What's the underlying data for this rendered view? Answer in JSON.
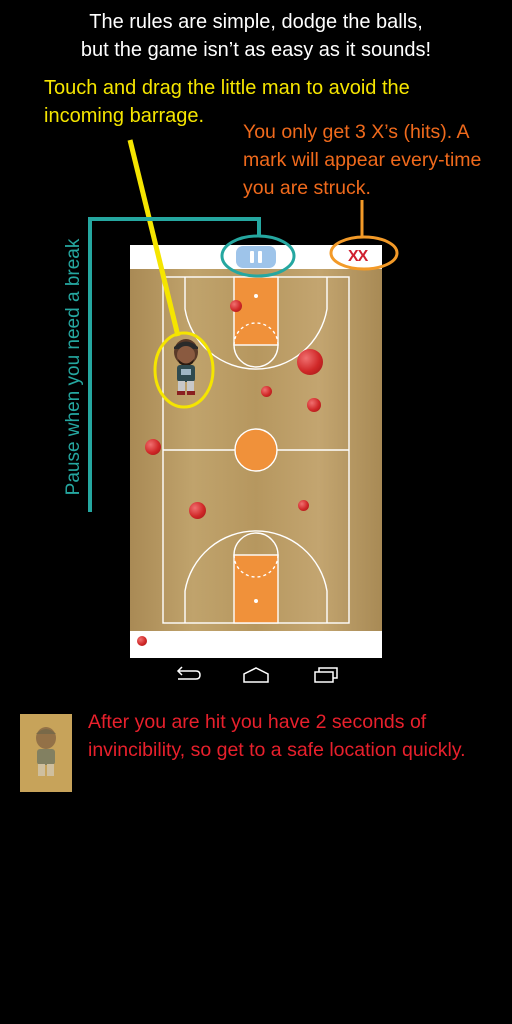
{
  "instructions": {
    "title": "The rules are simple, dodge the balls,\nbut the game isn’t as easy as it sounds!",
    "touch": "Touch and drag the little man to avoid the incoming barrage.",
    "hits": "You only get 3 X’s (hits). A mark will appear every-time you are struck.",
    "pause": "Pause when you need a break",
    "invincibility": "After you are hit you have 2 seconds of invincibility, so get to a safe location quickly."
  },
  "game": {
    "hit_marks": "XX",
    "pause_icon": "pause-icon"
  },
  "colors": {
    "title": "#ffffff",
    "touch": "#f5e500",
    "hits": "#f06a1c",
    "pause": "#25a7a0",
    "invincibility": "#e8202c",
    "court_wood": "#b89a62",
    "paint": "#f0913a",
    "ball": "#d02828"
  },
  "navigation": {
    "back_icon": "back-icon",
    "home_icon": "home-icon",
    "recents_icon": "recents-icon"
  }
}
